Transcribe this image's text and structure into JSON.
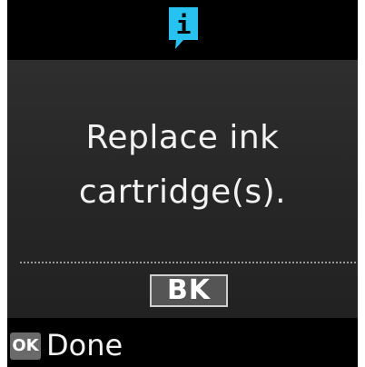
{
  "header": {
    "icon": "info-icon",
    "icon_glyph": "i",
    "icon_color": "#27c2ef"
  },
  "message": {
    "line1": "Replace ink",
    "line2": "cartridge(s)."
  },
  "cartridges": [
    {
      "label": "BK"
    }
  ],
  "footer": {
    "ok_key": "OK",
    "done_label": "Done"
  }
}
